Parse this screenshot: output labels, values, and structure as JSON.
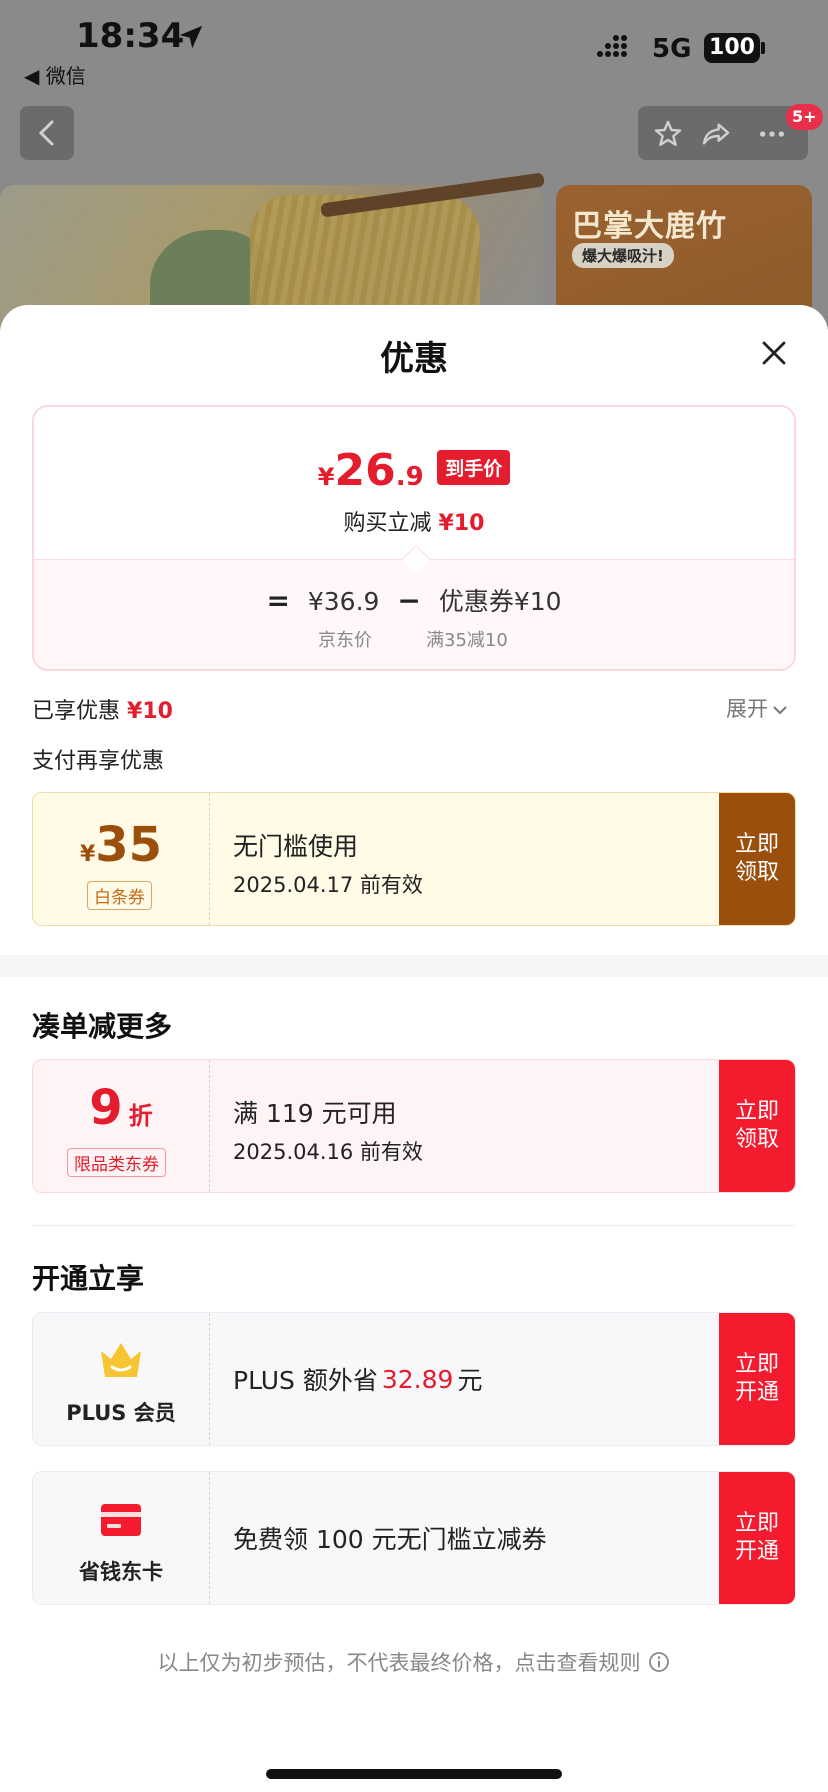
{
  "status_bar": {
    "time": "18:34",
    "back_app": "◀ 微信",
    "network": "5G",
    "battery": "100"
  },
  "nav": {
    "badge": "5+"
  },
  "background": {
    "card_title": "巴掌大鹿竹",
    "card_tag": "爆大爆吸汁!"
  },
  "sheet": {
    "title": "优惠",
    "price": {
      "currency": "¥",
      "final_int": "26",
      "final_dec": ".9",
      "final_tag": "到手价",
      "reduce_label": "购买立减",
      "reduce_amount": "¥10",
      "formula_eq": "=",
      "jd_price": "¥36.9",
      "formula_minus": "−",
      "coupon_formula": "优惠券¥10",
      "jd_price_label": "京东价",
      "coupon_rule": "满35减10"
    },
    "enjoyed_label": "已享优惠",
    "enjoyed_amount": "¥10",
    "expand_label": "展开",
    "pay_more_label": "支付再享优惠",
    "baitiao": {
      "currency": "¥",
      "amount": "35",
      "tag": "白条券",
      "line1": "无门槛使用",
      "line2": "2025.04.17 前有效",
      "button": "立即\n领取"
    },
    "more_section_title": "凑单减更多",
    "discount": {
      "big": "9",
      "unit": "折",
      "tag": "限品类东券",
      "line1": "满 119 元可用",
      "line2": "2025.04.16 前有效",
      "button": "立即\n领取"
    },
    "open_section_title": "开通立享",
    "plus": {
      "label": "PLUS 会员",
      "text_pre": "PLUS 额外省",
      "amount": "32.89",
      "text_post": "元",
      "button": "立即\n开通"
    },
    "card": {
      "label": "省钱东卡",
      "text": "免费领 100 元无门槛立减券",
      "button": "立即\n开通"
    },
    "disclaimer": "以上仅为初步预估，不代表最终价格，点击查看规则"
  },
  "colors": {
    "red": "#e31c2e",
    "brown": "#9a4f0d",
    "button_red": "#f51b2f"
  }
}
